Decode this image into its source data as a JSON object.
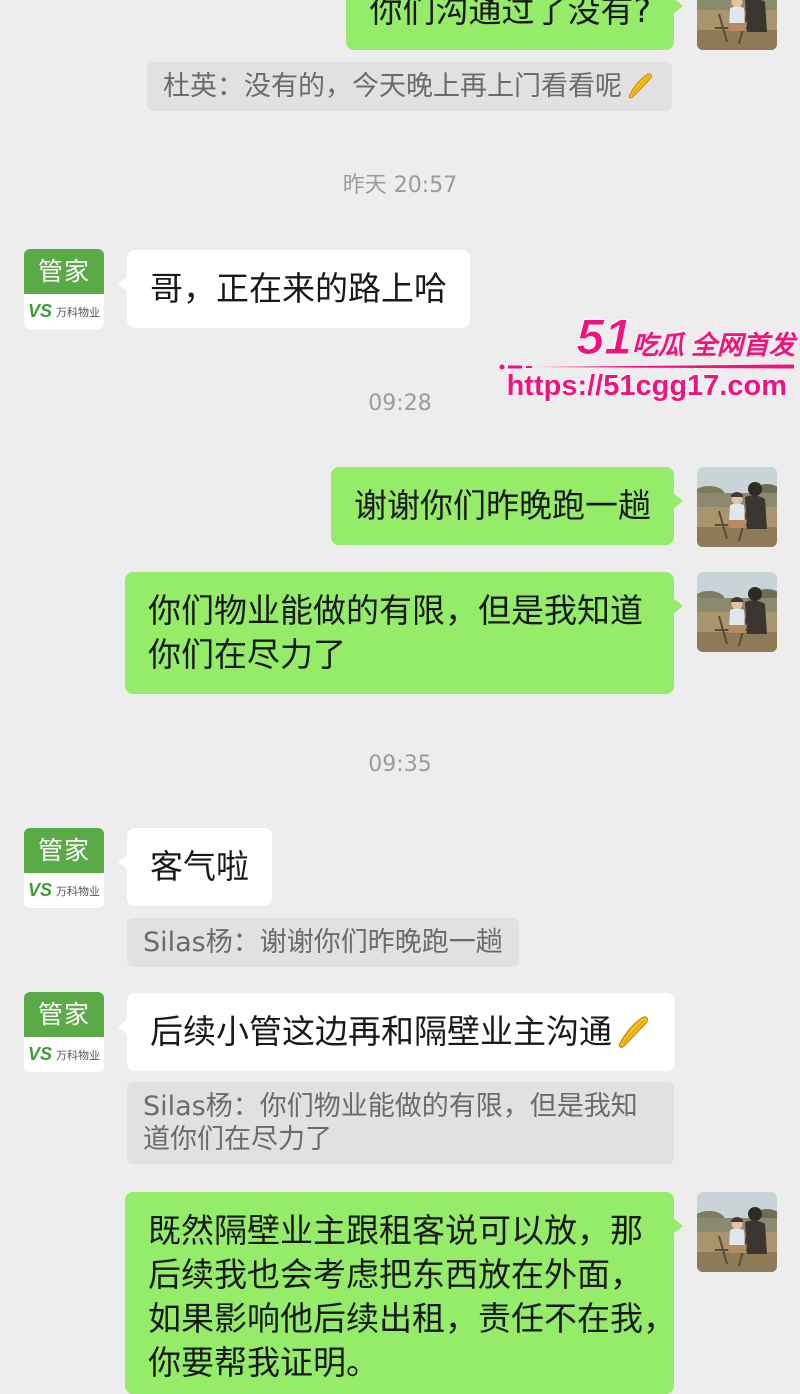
{
  "colors": {
    "background": "#ededed",
    "sent_bubble": "#95ec69",
    "received_bubble": "#ffffff",
    "quote_background": "#e1e1e1",
    "quote_text": "#6b6b6b",
    "timestamp": "#9b9b9b",
    "agent_avatar_green": "#5aaa48",
    "watermark": "#f2127e"
  },
  "agent_avatar": {
    "label": "管家",
    "logo_mark": "VS",
    "logo_text": "万科物业"
  },
  "user_avatar": {
    "icon": "user-photo"
  },
  "chat": {
    "msg_1": {
      "text": "你们沟通过了没有?"
    },
    "quote_1": {
      "text": "杜英：没有的，今天晚上再上门看看呢",
      "emoji": "hands-together-emoji"
    },
    "time_1": "昨天 20:57",
    "msg_2": {
      "text": "哥，正在来的路上哈"
    },
    "time_2": "09:28",
    "msg_3": {
      "text": "谢谢你们昨晚跑一趟"
    },
    "msg_4": {
      "lines": [
        "你们物业能做的有限，但是我知道",
        "你们在尽力了"
      ]
    },
    "time_3": "09:35",
    "msg_5": {
      "text": "客气啦"
    },
    "quote_2": {
      "text": "Silas杨：谢谢你们昨晚跑一趟"
    },
    "msg_6": {
      "text": "后续小管这边再和隔壁业主沟通",
      "emoji": "hands-together-emoji"
    },
    "quote_3": {
      "lines": [
        "Silas杨：你们物业能做的有限，但是我知",
        "道你们在尽力了"
      ]
    },
    "msg_7": {
      "lines": [
        "既然隔壁业主跟租客说可以放，那",
        "后续我也会考虑把东西放在外面，",
        "如果影响他后续出租，责任不在我，",
        "你要帮我证明。"
      ]
    }
  },
  "watermark": {
    "number": "51",
    "brand": "吃瓜",
    "slogan": "全网首发",
    "url": "https://51cgg17.com"
  }
}
